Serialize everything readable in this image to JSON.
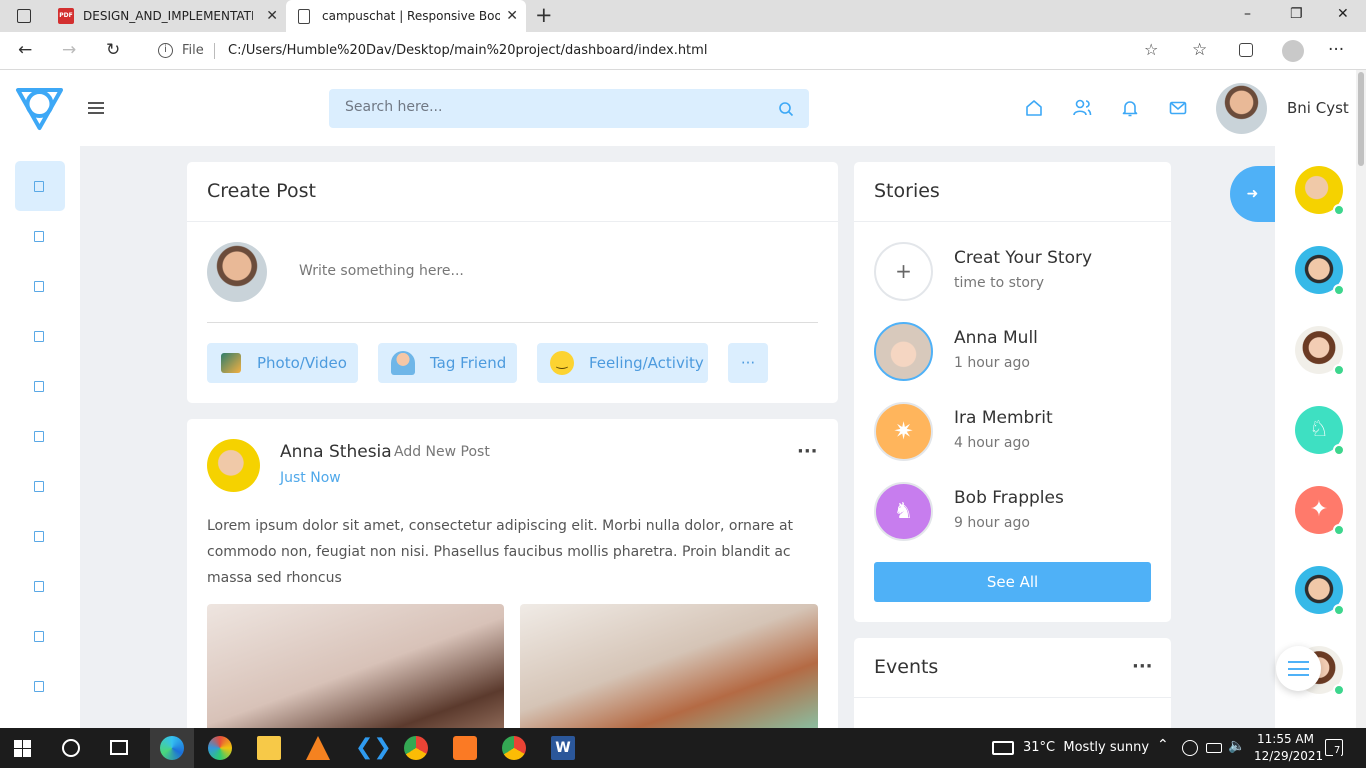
{
  "browser": {
    "tabs": [
      {
        "title": "DESIGN_AND_IMPLEMENTATION",
        "close": "✕"
      },
      {
        "title": "campuschat | Responsive Bootstr",
        "close": "✕"
      }
    ],
    "new_tab": "+",
    "window_controls": {
      "minimize": "–",
      "restore": "❐",
      "close": "✕"
    },
    "address": {
      "scheme_label": "File",
      "url": "C:/Users/Humble%20Dav/Desktop/main%20project/dashboard/index.html"
    }
  },
  "header": {
    "search_placeholder": "Search here...",
    "user_name": "Bni Cyst"
  },
  "create_post": {
    "title": "Create Post",
    "placeholder": "Write something here...",
    "actions": [
      {
        "label": "Photo/Video",
        "icon": "photo-icon"
      },
      {
        "label": "Tag Friend",
        "icon": "tag-friend-icon"
      },
      {
        "label": "Feeling/Activity",
        "icon": "smile-icon"
      }
    ],
    "more": "···"
  },
  "post": {
    "author": "Anna Sthesia",
    "action": "Add New Post",
    "time": "Just Now",
    "menu": "···",
    "text": "Lorem ipsum dolor sit amet, consectetur adipiscing elit. Morbi nulla dolor, ornare at commodo non, feugiat non nisi. Phasellus faucibus mollis pharetra. Proin blandit ac massa sed rhoncus"
  },
  "stories": {
    "title": "Stories",
    "create": {
      "name": "Creat Your Story",
      "subtitle": "time to story",
      "icon": "+"
    },
    "items": [
      {
        "name": "Anna Mull",
        "time": "1 hour ago"
      },
      {
        "name": "Ira Membrit",
        "time": "4 hour ago"
      },
      {
        "name": "Bob Frapples",
        "time": "9 hour ago"
      }
    ],
    "see_all": "See All"
  },
  "events": {
    "title": "Events",
    "menu": "···"
  },
  "taskbar": {
    "weather": "31°C  Mostly sunny",
    "time": "11:55 AM",
    "date": "12/29/2021",
    "notification_count": "7"
  },
  "colors": {
    "accent": "#4fb1f7",
    "accent_light": "#dbeefe",
    "online": "#3cd68d"
  }
}
